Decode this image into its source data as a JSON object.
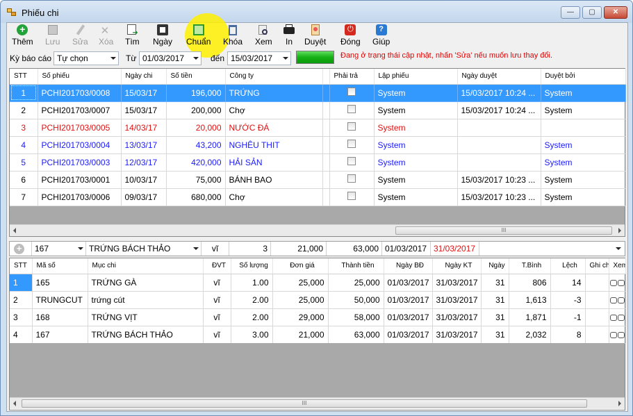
{
  "window": {
    "title": "Phiếu chi",
    "minimize": "—",
    "maximize": "▢",
    "close": "✕"
  },
  "toolbar": [
    {
      "label": "Thêm",
      "icon": "add-icon",
      "enabled": true
    },
    {
      "label": "Lưu",
      "icon": "save-icon",
      "enabled": false
    },
    {
      "label": "Sửa",
      "icon": "edit-icon",
      "enabled": false
    },
    {
      "label": "Xóa",
      "icon": "delete-icon",
      "enabled": false
    },
    {
      "label": "Tìm",
      "icon": "find-icon",
      "enabled": true
    },
    {
      "label": "Ngày",
      "icon": "calendar-icon",
      "enabled": true
    },
    {
      "label": "Chuẩn",
      "icon": "approve-icon",
      "enabled": true
    },
    {
      "label": "Khóa",
      "icon": "lock-icon",
      "enabled": true
    },
    {
      "label": "Xem",
      "icon": "view-icon",
      "enabled": true
    },
    {
      "label": "In",
      "icon": "print-icon",
      "enabled": true
    },
    {
      "label": "Duyệt",
      "icon": "approve-doc-icon",
      "enabled": true
    },
    {
      "label": "Đóng",
      "icon": "power-icon",
      "enabled": true
    },
    {
      "label": "Giúp",
      "icon": "help-icon",
      "enabled": true
    }
  ],
  "filter": {
    "period_label": "Kỳ báo cáo",
    "period_value": "Tự chọn",
    "from_label": "Từ",
    "from_date": "01/03/2017",
    "to_label": "đến",
    "to_date": "15/03/2017",
    "status_message": "Đang ở trạng thái cập nhật, nhấn 'Sửa' nếu muốn lưu thay đổi.",
    "progress": 1.0
  },
  "master": {
    "columns": [
      "STT",
      "Số phiếu",
      "Ngày chi",
      "Số tiền",
      "Công ty",
      "",
      "Phải trả",
      "Lập phiếu",
      "Ngày duyệt",
      "Duyệt bởi"
    ],
    "rows": [
      {
        "stt": "1",
        "so_phieu": "PCHI201703/0008",
        "ngay_chi": "15/03/17",
        "so_tien": "196,000",
        "cong_ty": "TRỨNG",
        "phai_tra": false,
        "lap_phieu": "System",
        "ngay_duyet": "15/03/2017 10:24 ...",
        "duyet_boi": "System",
        "style": "sel"
      },
      {
        "stt": "2",
        "so_phieu": "PCHI201703/0007",
        "ngay_chi": "15/03/17",
        "so_tien": "200,000",
        "cong_ty": "Chợ",
        "phai_tra": false,
        "lap_phieu": "System",
        "ngay_duyet": "15/03/2017 10:24 ...",
        "duyet_boi": "System",
        "style": ""
      },
      {
        "stt": "3",
        "so_phieu": "PCHI201703/0005",
        "ngay_chi": "14/03/17",
        "so_tien": "20,000",
        "cong_ty": "NƯỚC ĐÁ",
        "phai_tra": false,
        "lap_phieu": "System",
        "ngay_duyet": "",
        "duyet_boi": "",
        "style": "red"
      },
      {
        "stt": "4",
        "so_phieu": "PCHI201703/0004",
        "ngay_chi": "13/03/17",
        "so_tien": "43,200",
        "cong_ty": "NGHÊU THIT",
        "phai_tra": false,
        "lap_phieu": "System",
        "ngay_duyet": "",
        "duyet_boi": "System",
        "style": "blue"
      },
      {
        "stt": "5",
        "so_phieu": "PCHI201703/0003",
        "ngay_chi": "12/03/17",
        "so_tien": "420,000",
        "cong_ty": "HẢI SẢN",
        "phai_tra": false,
        "lap_phieu": "System",
        "ngay_duyet": "",
        "duyet_boi": "System",
        "style": "blue"
      },
      {
        "stt": "6",
        "so_phieu": "PCHI201703/0001",
        "ngay_chi": "10/03/17",
        "so_tien": "75,000",
        "cong_ty": "BÁNH BAO",
        "phai_tra": false,
        "lap_phieu": "System",
        "ngay_duyet": "15/03/2017 10:23 ...",
        "duyet_boi": "System",
        "style": ""
      },
      {
        "stt": "7",
        "so_phieu": "PCHI201703/0006",
        "ngay_chi": "09/03/17",
        "so_tien": "680,000",
        "cong_ty": "Chợ",
        "phai_tra": false,
        "lap_phieu": "System",
        "ngay_duyet": "15/03/2017 10:23 ...",
        "duyet_boi": "System",
        "style": ""
      }
    ]
  },
  "entry": {
    "code": "167",
    "item": "TRỨNG BÁCH THẢO",
    "unit": "vĩ",
    "quantity": "3",
    "price": "21,000",
    "amount": "63,000",
    "start": "01/03/2017",
    "end": "31/03/2017"
  },
  "detail": {
    "columns": [
      "STT",
      "Mã số",
      "Mục chi",
      "ĐVT",
      "Số lượng",
      "Đơn giá",
      "Thành tiền",
      "Ngày BĐ",
      "Ngày KT",
      "Ngày",
      "T.Bình",
      "Lệch",
      "Ghi chú",
      "Xem"
    ],
    "rows": [
      {
        "stt": "1",
        "ma_so": "165",
        "muc_chi": "TRỨNG GÀ",
        "dvt": "vĩ",
        "so_luong": "1.00",
        "don_gia": "25,000",
        "thanh_tien": "25,000",
        "ngay_bd": "01/03/2017",
        "ngay_kt": "31/03/2017",
        "ngay": "31",
        "tbinh": "806",
        "lech": "14"
      },
      {
        "stt": "2",
        "ma_so": "TRUNGCUT",
        "muc_chi": "trứng cút",
        "dvt": "vĩ",
        "so_luong": "2.00",
        "don_gia": "25,000",
        "thanh_tien": "50,000",
        "ngay_bd": "01/03/2017",
        "ngay_kt": "31/03/2017",
        "ngay": "31",
        "tbinh": "1,613",
        "lech": "-3"
      },
      {
        "stt": "3",
        "ma_so": "168",
        "muc_chi": "TRỨNG VỊT",
        "dvt": "vĩ",
        "so_luong": "2.00",
        "don_gia": "29,000",
        "thanh_tien": "58,000",
        "ngay_bd": "01/03/2017",
        "ngay_kt": "31/03/2017",
        "ngay": "31",
        "tbinh": "1,871",
        "lech": "-1"
      },
      {
        "stt": "4",
        "ma_so": "167",
        "muc_chi": "TRỨNG BÁCH THẢO",
        "dvt": "vĩ",
        "so_luong": "3.00",
        "don_gia": "21,000",
        "thanh_tien": "63,000",
        "ngay_bd": "01/03/2017",
        "ngay_kt": "31/03/2017",
        "ngay": "31",
        "tbinh": "2,032",
        "lech": "8"
      }
    ]
  },
  "scrollbar": {
    "thumb_grip": "III"
  }
}
